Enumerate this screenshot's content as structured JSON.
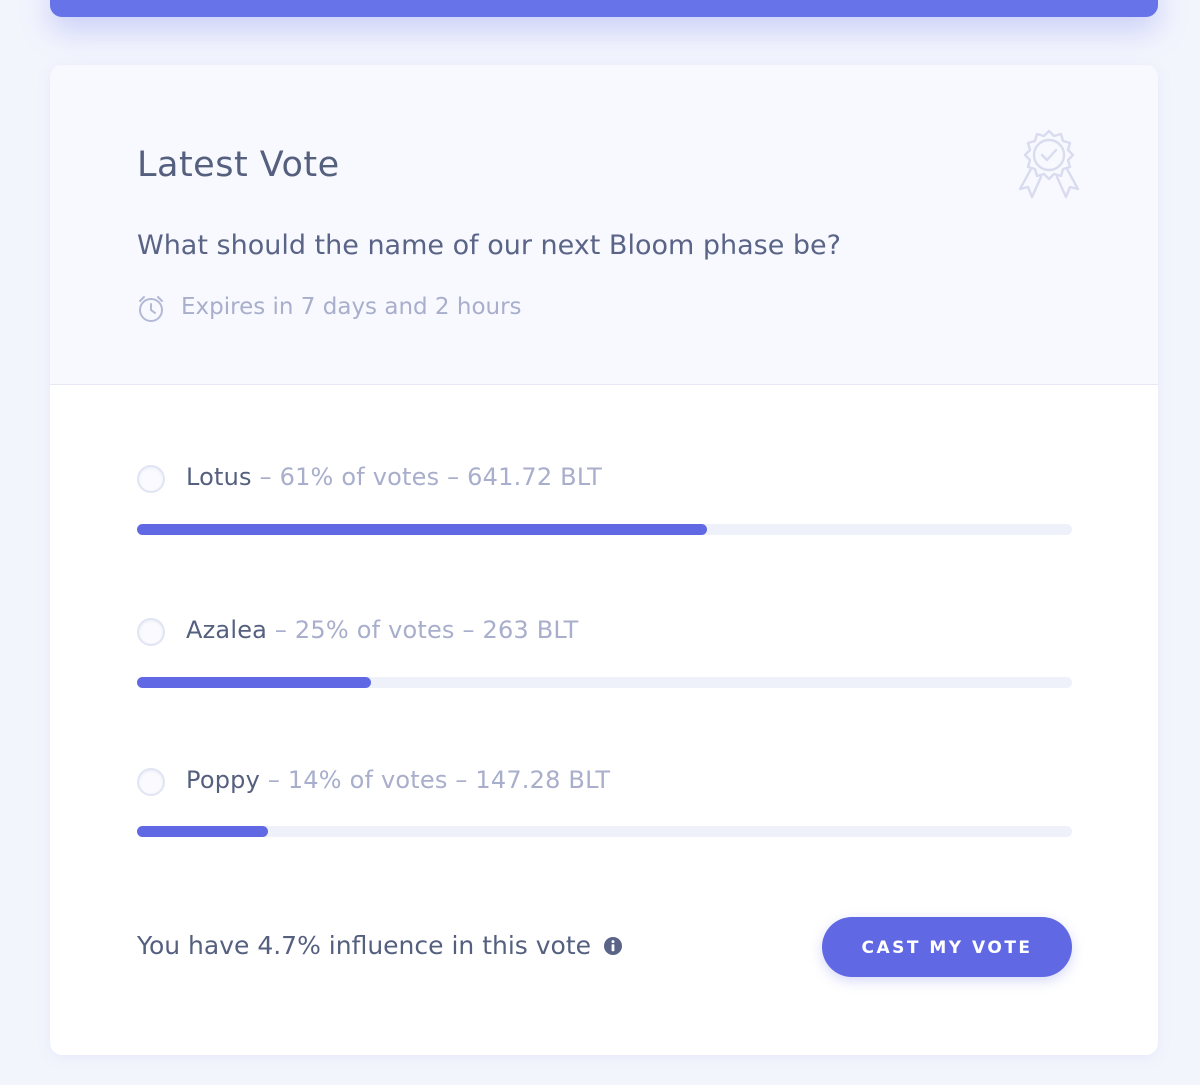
{
  "card": {
    "title": "Latest Vote",
    "question": "What should the name of our next Bloom phase be?",
    "expiry": "Expires in 7 days and 2 hours",
    "icons": {
      "badge": "award-badge-icon",
      "expiry": "alarm-clock-icon",
      "info": "info-icon"
    }
  },
  "options": [
    {
      "name": "Lotus",
      "stats": " – 61% of votes – 641.72 BLT",
      "percent": 61
    },
    {
      "name": "Azalea",
      "stats": " – 25% of votes – 263 BLT",
      "percent": 25
    },
    {
      "name": "Poppy",
      "stats": " – 14% of votes – 147.28 BLT",
      "percent": 14
    }
  ],
  "footer": {
    "influence": "You have 4.7% influence in this vote",
    "cast_button": "CAST MY VOTE"
  },
  "colors": {
    "accent": "#6068e4",
    "header_bar": "#6773e8",
    "muted_text": "#a8aecb",
    "primary_text": "#55607f",
    "track": "#eef0fa"
  }
}
